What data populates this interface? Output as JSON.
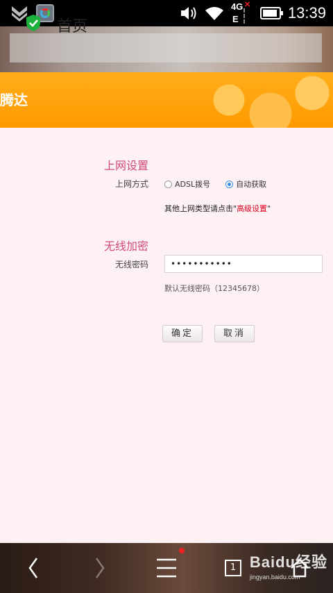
{
  "status_bar": {
    "time": "13:39",
    "network_type": "4G",
    "network_sub": "E",
    "icons": [
      "notification-arrow-icon",
      "app-icon",
      "volume-icon",
      "wifi-icon",
      "cellular-icon",
      "battery-icon"
    ]
  },
  "browser": {
    "page_title": "首页",
    "security_icon": "shield-check-icon"
  },
  "banner": {
    "brand_text": "腾达",
    "color": "#ff9f0a"
  },
  "form": {
    "internet_section_title": "上网设置",
    "connection_label": "上网方式",
    "options": [
      {
        "label": "ADSL拨号",
        "checked": false
      },
      {
        "label": "自动获取",
        "checked": true
      }
    ],
    "hint_prefix": "其他上网类型请点击\"",
    "hint_link": "高级设置",
    "hint_suffix": "\"",
    "wireless_section_title": "无线加密",
    "password_label": "无线密码",
    "password_value": "•••••••••••",
    "password_note": "默认无线密码（12345678）",
    "confirm_label": "确定",
    "cancel_label": "取消"
  },
  "bottom_nav": {
    "items": [
      "back-icon",
      "forward-icon",
      "menu-icon",
      "tabs-icon",
      "home-icon"
    ],
    "tab_count": "1"
  },
  "watermark": {
    "logo": "Baidu经验",
    "url": "jingyan.baidu.com"
  }
}
